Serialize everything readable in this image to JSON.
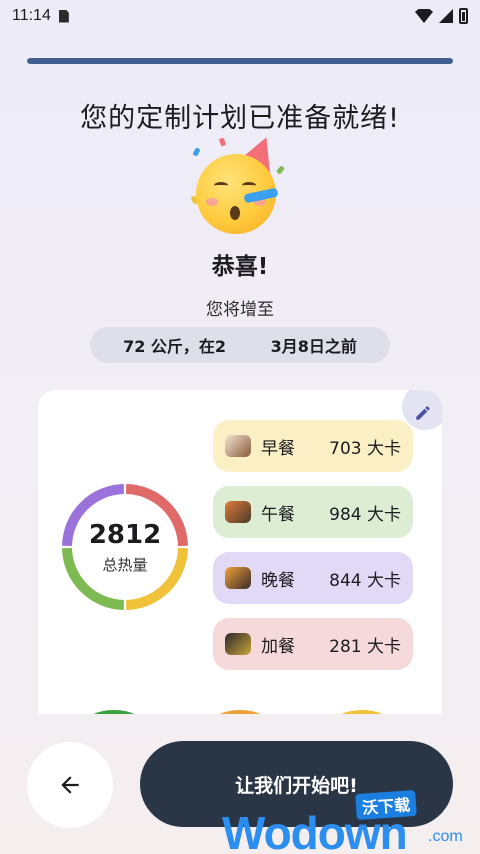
{
  "status_bar": {
    "time": "11:14"
  },
  "progress": {
    "fraction": 1.0,
    "color": "#3e5f8f"
  },
  "header": {
    "title": "您的定制计划已准备就绪!"
  },
  "hero": {
    "emoji": "partying-face-emoji",
    "congrats": "恭喜!",
    "subtitle": "您将增至",
    "goal": "72 公斤，在2        3月8日之前"
  },
  "summary": {
    "total_value": "2812",
    "total_label": "总热量",
    "ring_colors": [
      "#e06a6a",
      "#f0c23a",
      "#7dbb52",
      "#9b72d9"
    ],
    "meals": [
      {
        "name": "早餐",
        "kcal": "703 大卡",
        "bg": "#fbefc6",
        "icon": "breakfast-icon"
      },
      {
        "name": "午餐",
        "kcal": "984 大卡",
        "bg": "#dcedd4",
        "icon": "lunch-icon"
      },
      {
        "name": "晚餐",
        "kcal": "844 大卡",
        "bg": "#e2d9f6",
        "icon": "dinner-icon"
      },
      {
        "name": "加餐",
        "kcal": "281 大卡",
        "bg": "#f6d9da",
        "icon": "snack-icon"
      }
    ]
  },
  "footer": {
    "start_label": "让我们开始吧!"
  },
  "watermark": {
    "badge": "沃下载",
    "text": "Wodown",
    "suffix": ".com"
  }
}
